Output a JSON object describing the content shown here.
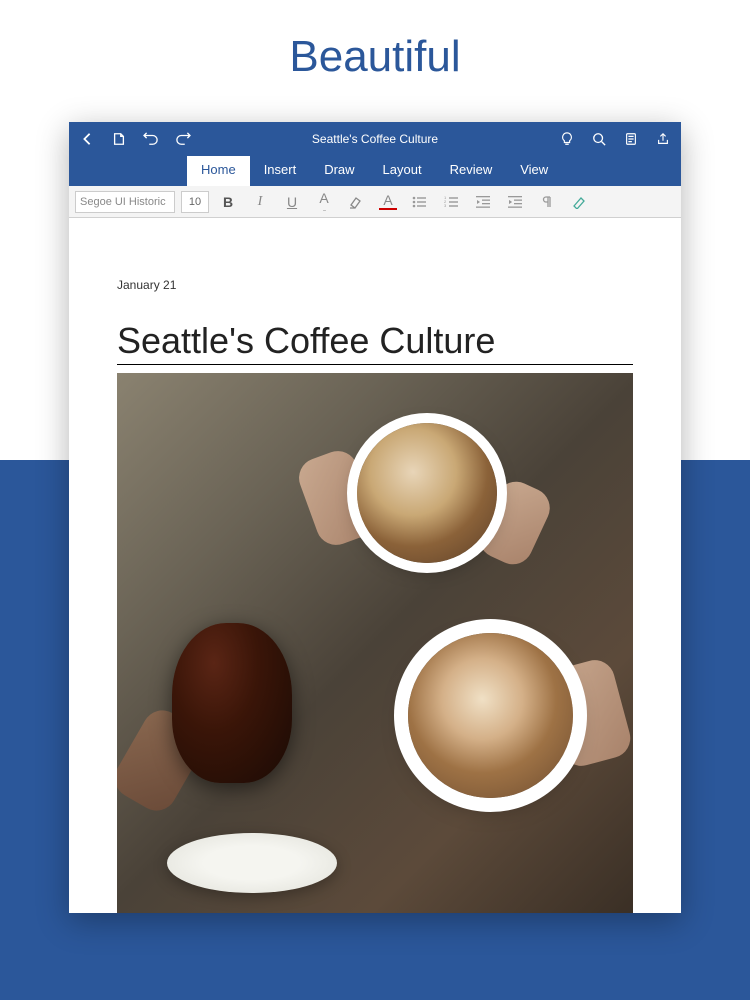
{
  "hero": {
    "title": "Beautiful"
  },
  "app": {
    "document_title": "Seattle's Coffee Culture",
    "tabs": [
      {
        "label": "Home",
        "active": true
      },
      {
        "label": "Insert",
        "active": false
      },
      {
        "label": "Draw",
        "active": false
      },
      {
        "label": "Layout",
        "active": false
      },
      {
        "label": "Review",
        "active": false
      },
      {
        "label": "View",
        "active": false
      }
    ],
    "toolbar": {
      "font_name": "Segoe UI Historic",
      "font_size": "10",
      "bold": "B",
      "italic": "I",
      "underline": "U",
      "font_style": "A",
      "highlight": "",
      "font_color": "A"
    }
  },
  "document": {
    "date": "January 21",
    "title": "Seattle's Coffee Culture"
  },
  "colors": {
    "brand": "#2b579a"
  }
}
